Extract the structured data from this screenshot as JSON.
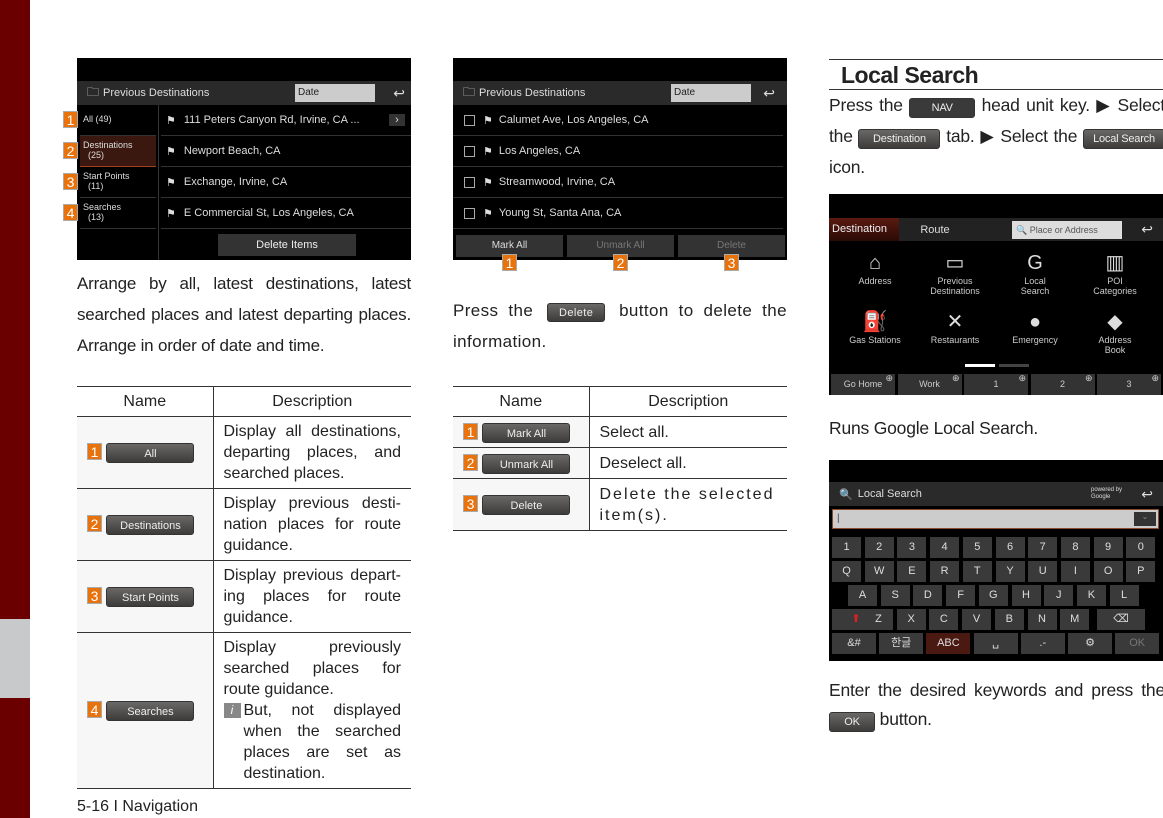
{
  "shot1": {
    "title": "Previous Destinations",
    "sort": "Date",
    "tabs": [
      {
        "n": "1",
        "l1": "All (49)",
        "l2": ""
      },
      {
        "n": "2",
        "l1": "Destinations",
        "l2": "(25)"
      },
      {
        "n": "3",
        "l1": "Start Points",
        "l2": "(11)"
      },
      {
        "n": "4",
        "l1": "Searches",
        "l2": "(13)"
      }
    ],
    "items": [
      "111 Peters Canyon Rd, Irvine, CA ...",
      "Newport Beach, CA",
      "Exchange, Irvine, CA",
      "E Commercial St, Los Angeles, CA"
    ],
    "delete": "Delete Items"
  },
  "left_text": "Arrange by all, latest destinations, latest searched places and latest departing places. Arrange in order of date and time.",
  "table1": {
    "h_name": "Name",
    "h_desc": "Description",
    "rows": [
      {
        "n": "1",
        "btn": "All",
        "desc": "Display all destinations, departing places, and searched places.",
        "note": ""
      },
      {
        "n": "2",
        "btn": "Destinations",
        "desc": "Display previous desti-nation places for route guidance.",
        "note": ""
      },
      {
        "n": "3",
        "btn": "Start Points",
        "desc": "Display previous depart-ing places for route guidance.",
        "note": ""
      },
      {
        "n": "4",
        "btn": "Searches",
        "desc": "Display previously searched places for route guidance.",
        "note": "But, not displayed when the searched places are set as destination."
      }
    ]
  },
  "shot2": {
    "title": "Previous Destinations",
    "sort": "Date",
    "items": [
      "Calumet Ave, Los Angeles, CA",
      "Los Angeles, CA",
      "Streamwood, Irvine, CA",
      "Young St, Santa Ana, CA"
    ],
    "buttons": [
      "Mark All",
      "Unmark All",
      "Delete"
    ],
    "nums": [
      "1",
      "2",
      "3"
    ]
  },
  "mid_text": {
    "pre": "Press the",
    "btn": "Delete",
    "post": "button to delete the information."
  },
  "table2": {
    "h_name": "Name",
    "h_desc": "Description",
    "rows": [
      {
        "n": "1",
        "btn": "Mark All",
        "desc": "Select all."
      },
      {
        "n": "2",
        "btn": "Unmark All",
        "desc": "Deselect all."
      },
      {
        "n": "3",
        "btn": "Delete",
        "desc": "Delete the selected item(s)."
      }
    ]
  },
  "right": {
    "heading": "Local Search",
    "t1": "Press the",
    "nav": "NAV",
    "t2": "head unit key. ▶ Select the",
    "dest": "Destination",
    "t3": "tab. ▶ Select the",
    "ls": "Local Search",
    "t4": "icon.",
    "runs": "Runs Google Local Search.",
    "enter": "Enter the desired keywords and press the",
    "ok": "OK",
    "button": "button."
  },
  "shot3": {
    "tabs": [
      "Destination",
      "Route"
    ],
    "search_placeholder": "Place or Address",
    "icons": [
      {
        "g": "⌂",
        "l": "Address"
      },
      {
        "g": "▭",
        "l": "Previous Destinations"
      },
      {
        "g": "G",
        "l": "Local Search"
      },
      {
        "g": "▥",
        "l": "POI Categories"
      },
      {
        "g": "⛽",
        "l": "Gas Stations"
      },
      {
        "g": "✕",
        "l": "Restaurants"
      },
      {
        "g": "●",
        "l": "Emergency"
      },
      {
        "g": "◆",
        "l": "Address Book"
      }
    ],
    "quick": [
      "Go Home",
      "Work",
      "1",
      "2",
      "3"
    ]
  },
  "shot4": {
    "title": "Local Search",
    "powered": "powered by Google",
    "input": "|",
    "rows": [
      [
        "1",
        "2",
        "3",
        "4",
        "5",
        "6",
        "7",
        "8",
        "9",
        "0"
      ],
      [
        "Q",
        "W",
        "E",
        "R",
        "T",
        "Y",
        "U",
        "I",
        "O",
        "P"
      ],
      [
        "A",
        "S",
        "D",
        "F",
        "G",
        "H",
        "J",
        "K",
        "L"
      ],
      [
        "⬆",
        "Z",
        "X",
        "C",
        "V",
        "B",
        "N",
        "M",
        "⌫"
      ],
      [
        "&#",
        "한글",
        "ABC",
        "␣",
        ".-",
        "⚙",
        "OK"
      ]
    ]
  },
  "footer": "5-16 I Navigation",
  "colors": {
    "accent": "#e8720c",
    "brand": "#6b0000"
  }
}
